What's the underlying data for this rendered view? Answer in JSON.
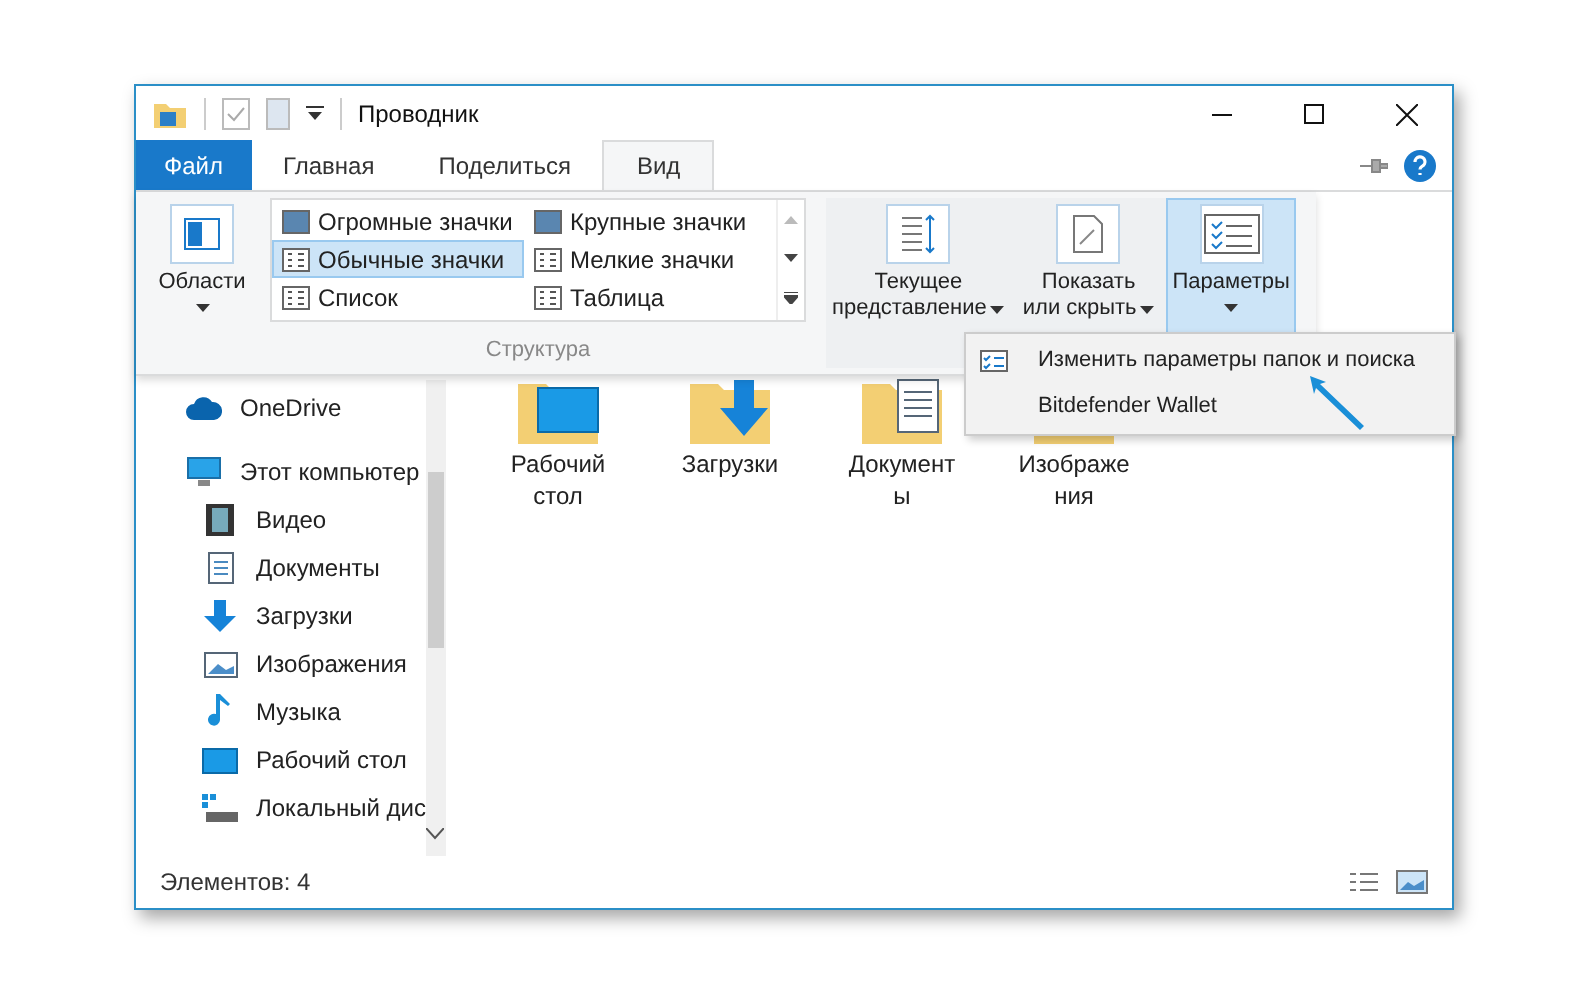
{
  "window": {
    "title": "Проводник"
  },
  "tabs": [
    {
      "label": "Файл",
      "kind": "file",
      "selected": false
    },
    {
      "label": "Главная",
      "kind": "tab",
      "selected": false
    },
    {
      "label": "Поделиться",
      "kind": "tab",
      "selected": false
    },
    {
      "label": "Вид",
      "kind": "tab",
      "selected": true
    }
  ],
  "ribbon": {
    "panes": {
      "label": "Области"
    },
    "layout": {
      "caption": "Структура",
      "items": [
        {
          "label": "Огромные значки",
          "selected": false
        },
        {
          "label": "Крупные значки",
          "selected": false
        },
        {
          "label": "Обычные значки",
          "selected": true
        },
        {
          "label": "Мелкие значки",
          "selected": false
        },
        {
          "label": "Список",
          "selected": false
        },
        {
          "label": "Таблица",
          "selected": false
        }
      ]
    },
    "current_view": {
      "lines": [
        "Текущее",
        "представление"
      ]
    },
    "show_hide": {
      "lines": [
        "Показать",
        "или скрыть"
      ]
    },
    "options": {
      "label": "Параметры",
      "selected": true
    }
  },
  "options_menu": [
    {
      "label": "Изменить параметры папок и поиска"
    },
    {
      "label": "Bitdefender Wallet"
    }
  ],
  "navigation": [
    {
      "label": "OneDrive"
    },
    {
      "label": "Этот компьютер",
      "children": [
        {
          "label": "Видео"
        },
        {
          "label": "Документы"
        },
        {
          "label": "Загрузки"
        },
        {
          "label": "Изображения"
        },
        {
          "label": "Музыка"
        },
        {
          "label": "Рабочий стол"
        },
        {
          "label": "Локальный дис"
        }
      ]
    }
  ],
  "content": [
    {
      "lines": [
        "Рабочий",
        "стол"
      ]
    },
    {
      "lines": [
        "Загрузки"
      ]
    },
    {
      "lines": [
        "Документ",
        "ы"
      ]
    },
    {
      "lines": [
        "Изображе",
        "ния"
      ]
    }
  ],
  "status_bar": {
    "text": "Элементов: 4"
  }
}
